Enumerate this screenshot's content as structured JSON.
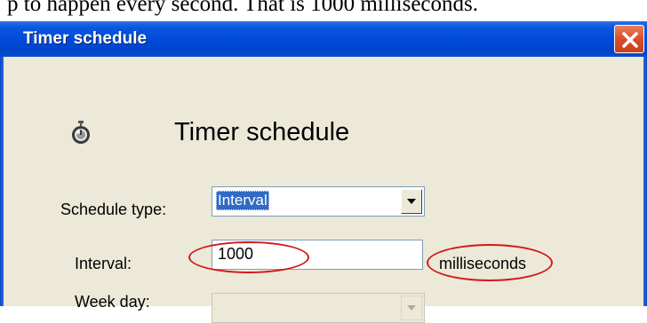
{
  "caption": {
    "text": "p to happen every second. That is 1000 milliseconds."
  },
  "window": {
    "title": "Timer schedule",
    "close_icon": "close-icon",
    "titlebar_color": "#0049d8",
    "close_color": "#d8502a"
  },
  "dialog": {
    "heading": "Timer schedule",
    "heading_icon": "stopwatch-icon",
    "schedule_type": {
      "label": "Schedule type:",
      "value": "Interval"
    },
    "interval": {
      "label": "Interval:",
      "value": "1000",
      "unit": "milliseconds"
    },
    "week_day": {
      "label": "Week day:",
      "value": ""
    }
  },
  "annotation_color": "#d21a1a"
}
